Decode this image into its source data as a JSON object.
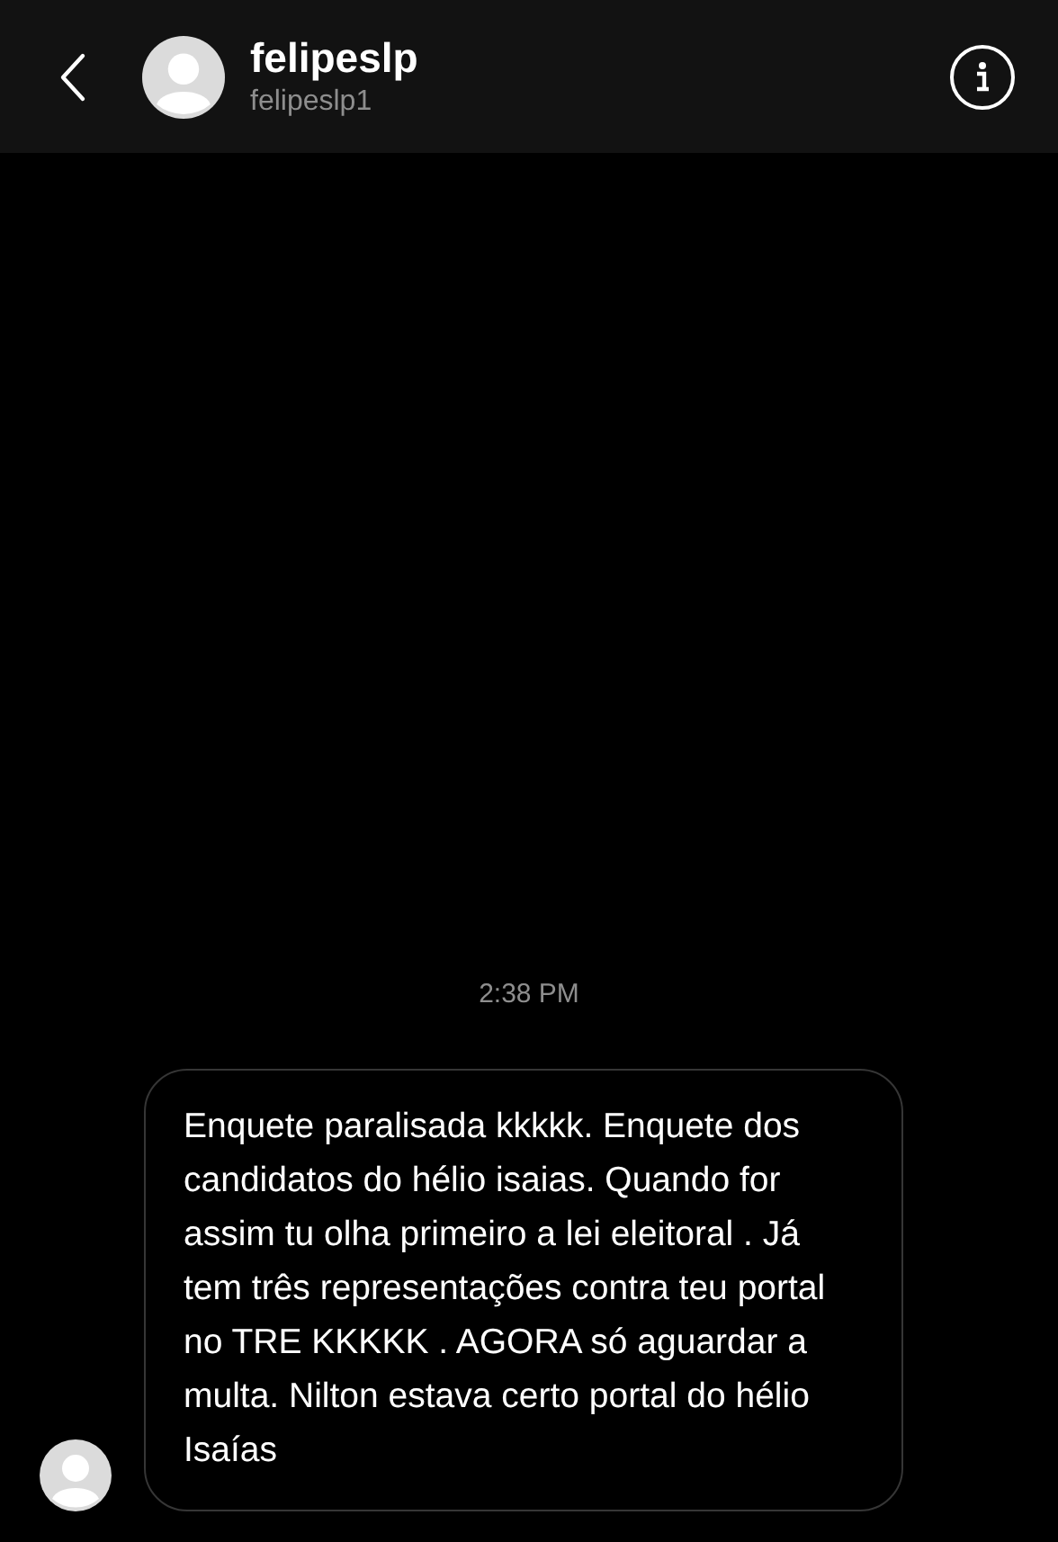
{
  "header": {
    "name": "felipeslp",
    "username": "felipeslp1"
  },
  "timestamp": "2:38 PM",
  "messages": [
    {
      "text": "Enquete paralisada kkkkk. Enquete dos candidatos do hélio isaias. Quando for assim tu olha primeiro a lei eleitoral . Já tem três representações contra teu portal no TRE KKKKK . AGORA só aguardar a multa. Nilton estava certo portal do hélio Isaías"
    }
  ]
}
